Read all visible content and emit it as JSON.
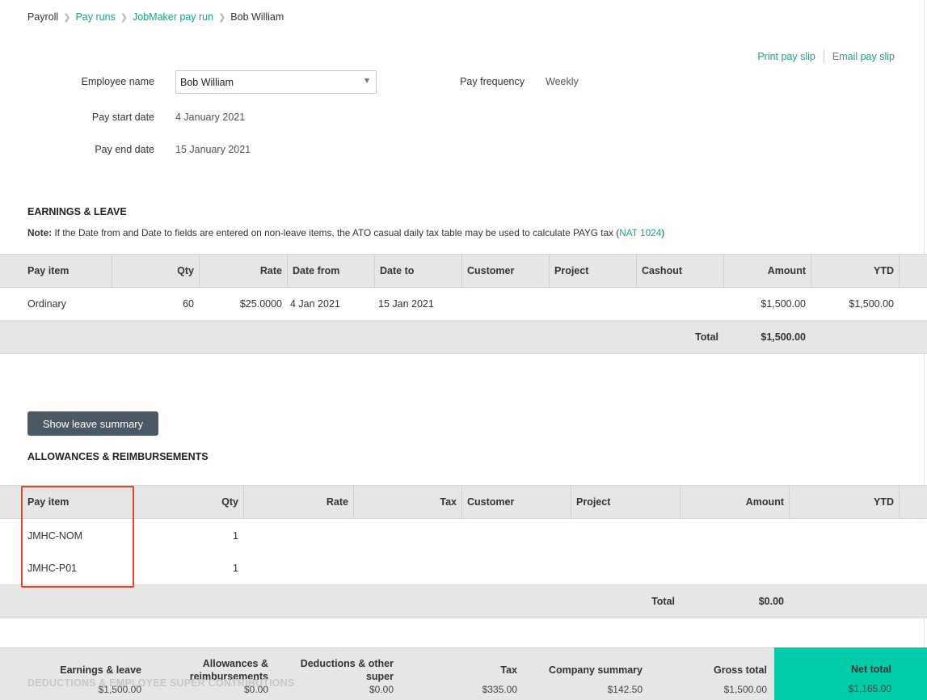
{
  "breadcrumb": {
    "root": "Payroll",
    "pay_runs": "Pay runs",
    "jobmaker": "JobMaker pay run",
    "current": "Bob William"
  },
  "actions": {
    "print": "Print pay slip",
    "email": "Email pay slip"
  },
  "form": {
    "employee_label": "Employee name",
    "employee_value": "Bob William",
    "pay_frequency_label": "Pay frequency",
    "pay_frequency_value": "Weekly",
    "start_label": "Pay start date",
    "start_value": "4 January 2021",
    "end_label": "Pay end date",
    "end_value": "15 January 2021"
  },
  "earnings": {
    "title": "EARNINGS & LEAVE",
    "note_bold": "Note:",
    "note_text": "If the Date from and Date to fields are entered on non-leave items, the ATO casual daily tax table may be used to calculate PAYG tax (",
    "note_link": "NAT 1024",
    "note_close": ")",
    "headers": {
      "pay_item": "Pay item",
      "qty": "Qty",
      "rate": "Rate",
      "date_from": "Date from",
      "date_to": "Date to",
      "customer": "Customer",
      "project": "Project",
      "cashout": "Cashout",
      "amount": "Amount",
      "ytd": "YTD"
    },
    "rows": [
      {
        "pay_item": "Ordinary",
        "qty": "60",
        "rate": "$25.0000",
        "date_from": "4 Jan 2021",
        "date_to": "15 Jan 2021",
        "amount": "$1,500.00",
        "ytd": "$1,500.00"
      }
    ],
    "total_label": "Total",
    "total_value": "$1,500.00"
  },
  "leave_button": "Show leave summary",
  "allowances": {
    "title": "ALLOWANCES & REIMBURSEMENTS",
    "headers": {
      "pay_item": "Pay item",
      "qty": "Qty",
      "rate": "Rate",
      "tax": "Tax",
      "customer": "Customer",
      "project": "Project",
      "amount": "Amount",
      "ytd": "YTD"
    },
    "rows": [
      {
        "pay_item": "JMHC-NOM",
        "qty": "1"
      },
      {
        "pay_item": "JMHC-P01",
        "qty": "1"
      }
    ],
    "total_label": "Total",
    "total_value": "$0.00"
  },
  "deductions_ghost": "DEDUCTIONS & EMPLOYEE SUPER CONTRIBUTIONS",
  "summary": {
    "earnings_label": "Earnings & leave",
    "earnings_value": "$1,500.00",
    "allowances_label_1": "Allowances &",
    "allowances_label_2": "reimbursements",
    "allowances_value": "$0.00",
    "deductions_label_1": "Deductions & other",
    "deductions_label_2": "super",
    "deductions_value": "$0.00",
    "tax_label": "Tax",
    "tax_value": "$335.00",
    "company_label": "Company summary",
    "company_value": "$142.50",
    "gross_label": "Gross total",
    "gross_value": "$1,500.00",
    "net_label": "Net total",
    "net_value": "$1,165.00"
  },
  "colors": {
    "accent": "#14a58e",
    "net_total_bg": "#00cca9",
    "button_bg": "#4a5865",
    "highlight": "#e2472a"
  }
}
